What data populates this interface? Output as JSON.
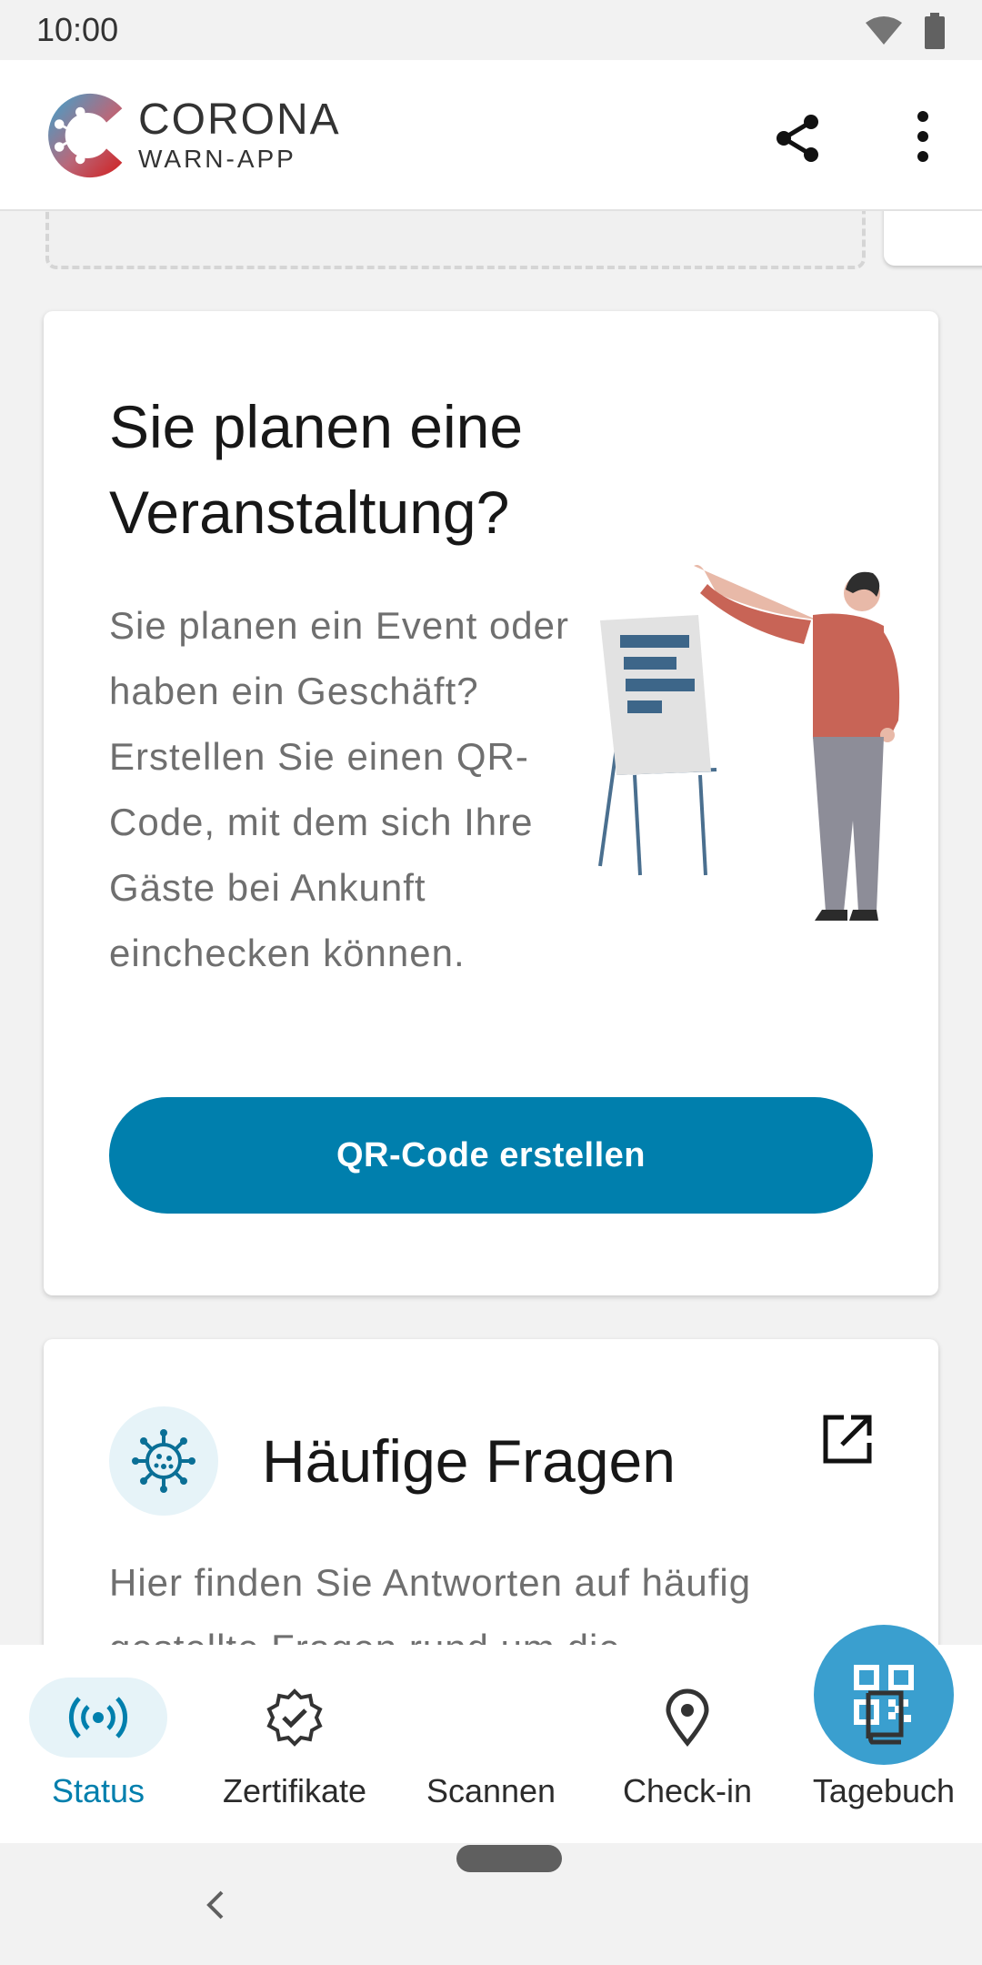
{
  "status_bar": {
    "time": "10:00",
    "icons": [
      "wifi-icon",
      "battery-icon"
    ]
  },
  "app_bar": {
    "brand_line1": "CORONA",
    "brand_line2": "WARN-APP",
    "actions": [
      "share-icon",
      "more-vert-icon"
    ]
  },
  "event_card": {
    "title": "Sie planen eine Veranstaltung?",
    "body": "Sie planen ein Event oder haben ein Geschäft? Erstellen Sie einen QR-Code, mit dem sich Ihre Gäste bei Ankunft einchecken können.",
    "button_label": "QR-Code erstellen"
  },
  "faq_card": {
    "title": "Häufige Fragen",
    "body": "Hier finden Sie Antworten auf häufig gestellte Fragen rund um die"
  },
  "bottom_nav": {
    "items": [
      {
        "label": "Status",
        "icon": "status-broadcast-icon",
        "active": true
      },
      {
        "label": "Zertifikate",
        "icon": "certificate-icon",
        "active": false
      },
      {
        "label": "Scannen",
        "icon": "qr-scan-icon",
        "active": false
      },
      {
        "label": "Check-in",
        "icon": "location-pin-icon",
        "active": false
      },
      {
        "label": "Tagebuch",
        "icon": "book-icon",
        "active": false
      }
    ]
  },
  "colors": {
    "accent": "#007fad",
    "fab": "#3a9fcf",
    "active_nav_bg": "#e6f3f8"
  }
}
